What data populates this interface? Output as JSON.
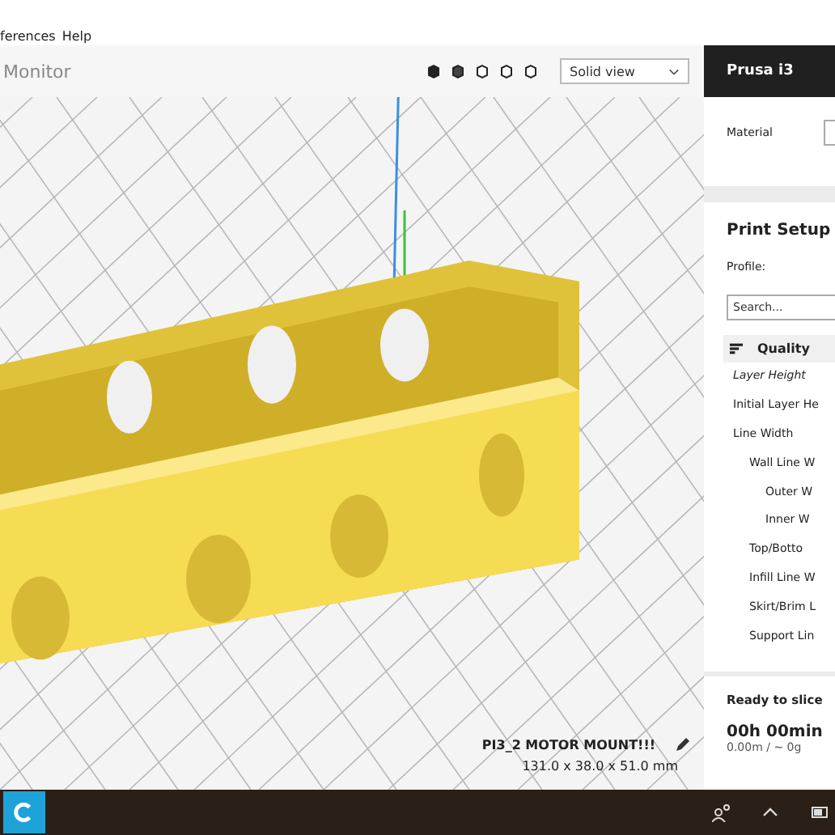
{
  "menu": [
    "ferences",
    "Help"
  ],
  "toolbar": {
    "stage": "Monitor",
    "view_mode": "Solid view"
  },
  "printer": "Prusa i3",
  "material": {
    "label": "Material"
  },
  "print_setup": {
    "title": "Print Setup",
    "profile_label": "Profile:",
    "search_placeholder": "Search...",
    "category": "Quality",
    "settings": [
      {
        "label": "Layer Height",
        "italic": true
      },
      {
        "label": "Initial Layer He",
        "italic": false
      },
      {
        "label": "Line Width",
        "italic": false,
        "children": [
          {
            "label": "Wall Line W",
            "italic": false,
            "children": [
              {
                "label": "Outer W",
                "italic": false
              },
              {
                "label": "Inner W",
                "italic": false
              }
            ]
          },
          {
            "label": "Top/Botto",
            "italic": false
          },
          {
            "label": "Infill Line W",
            "italic": false
          },
          {
            "label": "Skirt/Brim L",
            "italic": false
          },
          {
            "label": "Support Lin",
            "italic": false
          }
        ]
      }
    ]
  },
  "model": {
    "name": "PI3_2 MOTOR MOUNT!!!",
    "dimensions": "131.0 x 38.0 x 51.0 mm"
  },
  "slice": {
    "status": "Ready to slice",
    "time": "00h 00min",
    "usage": "0.00m / ~ 0g"
  }
}
